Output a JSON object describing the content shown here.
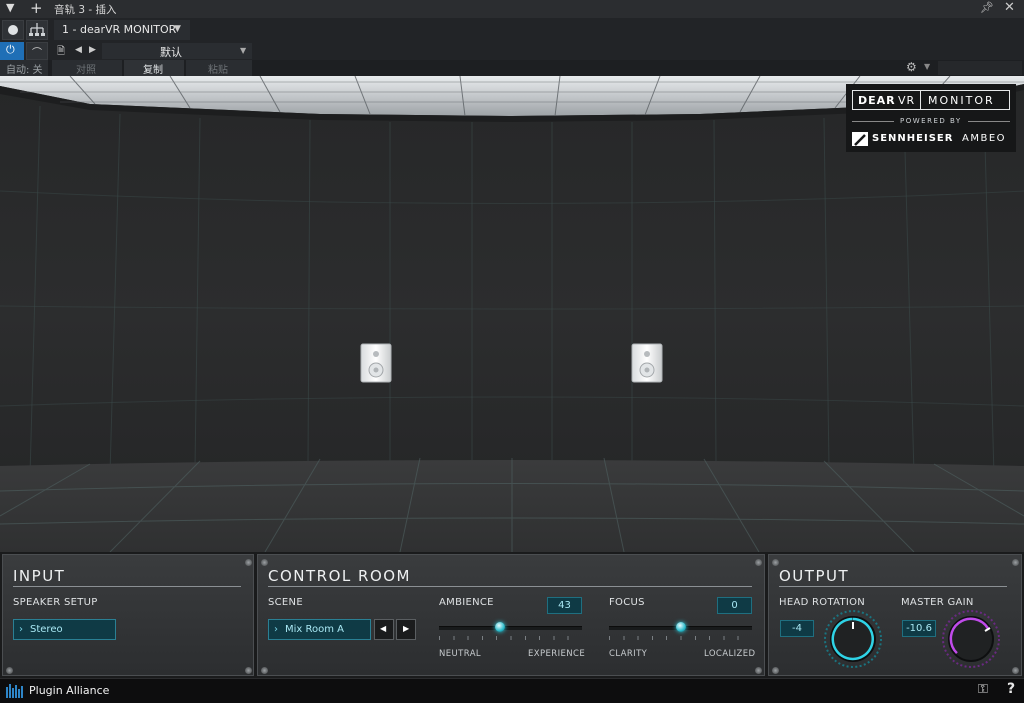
{
  "host": {
    "window_title": "音轨 3 - 插入",
    "plugin_select": "1 - dearVR MONITOR",
    "preset_name": "默认",
    "auto_label": "自动: 关",
    "compare_label": "对照",
    "copy_label": "复制",
    "paste_label": "粘贴"
  },
  "brand": {
    "logo_dear": "DEAR",
    "logo_vr": "VR",
    "logo_monitor": "MONITOR",
    "powered_by": "POWERED BY",
    "sennheiser": "SENNHEISER",
    "ambeo": "AMBEO"
  },
  "input": {
    "title": "INPUT",
    "speaker_setup_label": "SPEAKER SETUP",
    "speaker_setup_value": "Stereo"
  },
  "control_room": {
    "title": "CONTROL ROOM",
    "scene_label": "SCENE",
    "scene_value": "Mix Room A",
    "ambience_label": "AMBIENCE",
    "ambience_value": "43",
    "ambience_level": 0.43,
    "ambience_min_label": "NEUTRAL",
    "ambience_max_label": "EXPERIENCE",
    "focus_label": "FOCUS",
    "focus_value": "0",
    "focus_level": 0.5,
    "focus_min_label": "CLARITY",
    "focus_max_label": "LOCALIZED"
  },
  "output": {
    "title": "OUTPUT",
    "head_rotation_label": "HEAD ROTATION",
    "head_rotation_value": "-4",
    "master_gain_label": "MASTER GAIN",
    "master_gain_value": "-10.6"
  },
  "footer": {
    "brand_label": "Plugin Alliance",
    "help_label": "?"
  },
  "colors": {
    "accent_teal": "#29c7d9",
    "accent_purple": "#b03ad6"
  }
}
